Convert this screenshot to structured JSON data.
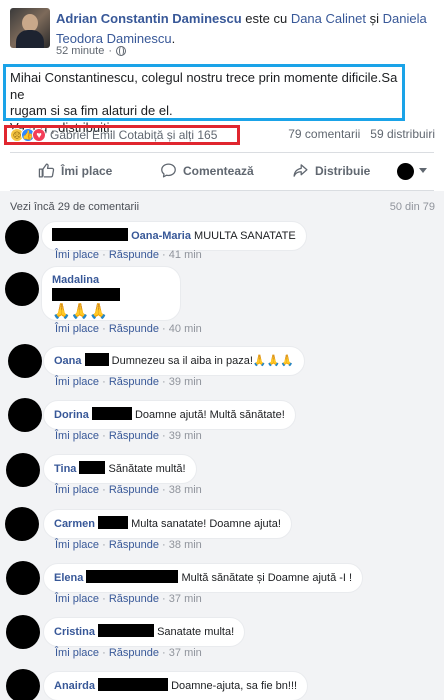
{
  "post": {
    "author": "Adrian Constantin Daminescu",
    "with_text": "este cu",
    "tag1": "Dana Calinet",
    "and_text": "și",
    "tag2": "Daniela Teodora Daminescu",
    "period": ".",
    "time": "52 minute",
    "time_sep": "·",
    "globe_icon": "globe-icon",
    "text_line1": "Mihai Constantinescu, colegul nostru trece prin momente dificile.Sa ne",
    "text_line2": "rugam si sa fim alaturi de el.",
    "text_line3": "Va rog , distribuiti.",
    "reactions_names": "Gabriel Emil Cotabiță și alți 165",
    "comments_count": "79 comentarii",
    "shares_count": "59 distribuiri",
    "highlight_text_color": "#1aa3e8",
    "highlight_reactions_color": "#e0262f"
  },
  "actions": {
    "like": "Îmi place",
    "comment": "Comentează",
    "share": "Distribuie"
  },
  "comments_header": {
    "more": "Vezi încă 29 de comentarii",
    "pager": "50 din 79"
  },
  "comment_actions": {
    "like": "Îmi place",
    "dot": "·",
    "reply": "Răspunde"
  },
  "comments": [
    {
      "name": "Oana-Maria",
      "text": "MUULTA SANATATE",
      "time": "41 min"
    },
    {
      "name": "Madalina",
      "text": "🙏🙏🙏",
      "time": "40 min"
    },
    {
      "name": "Oana",
      "text": "Dumnezeu sa il aiba in paza!🙏🙏🙏",
      "time": "39 min"
    },
    {
      "name": "Dorina",
      "text": "Doamne ajută! Multă sănătate!",
      "time": "39 min"
    },
    {
      "name": "Tina",
      "text": "Sănătate multă!",
      "time": "38 min"
    },
    {
      "name": "Carmen",
      "text": "Multa sanatate! Doamne ajuta!",
      "time": "38 min"
    },
    {
      "name": "Elena",
      "text": "Multă sănătate și Doamne ajută -I !",
      "time": "37 min"
    },
    {
      "name": "Cristina",
      "text": "Sanatate multa!",
      "time": "37 min"
    },
    {
      "name": "Anairda",
      "text": "Doamne-ajuta, sa fie bn!!!",
      "time": ""
    }
  ]
}
